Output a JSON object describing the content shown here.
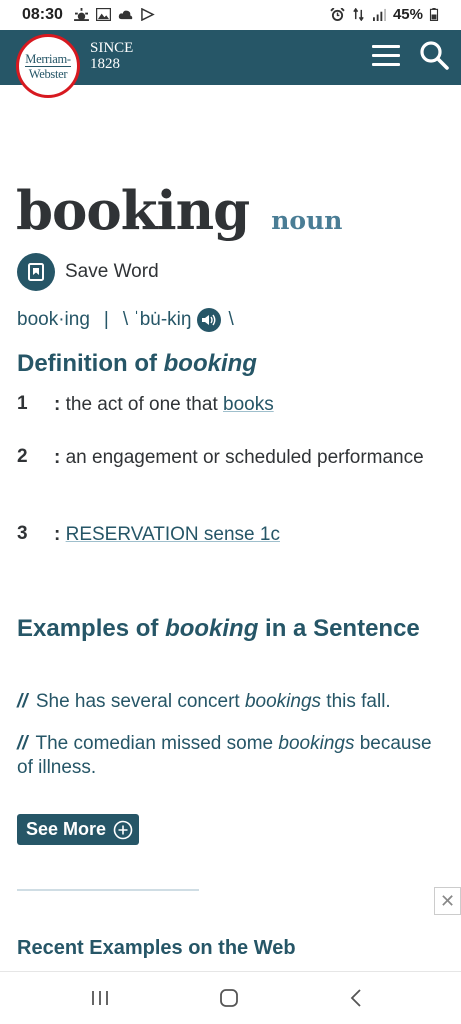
{
  "status_bar": {
    "time": "08:30",
    "battery": "45%",
    "left_icons": [
      "weather-icon",
      "gallery-icon",
      "cloud-icon",
      "play-store-icon"
    ],
    "right_icons": [
      "alarm-icon",
      "data-icon",
      "signal-icon",
      "battery-icon"
    ]
  },
  "header": {
    "logo_line1": "Merriam-",
    "logo_line2": "Webster",
    "since_line1": "SINCE",
    "since_line2": "1828",
    "menu_icon": "hamburger-menu-icon",
    "search_icon": "search-icon",
    "bg_color": "#265667",
    "logo_ring_color": "#d71920"
  },
  "entry": {
    "headword": "booking",
    "part_of_speech": "noun",
    "save_label": "Save Word",
    "syllables": "book·ing",
    "separator": "|",
    "pron_open": "\\ ˈbu̇-kiŋ",
    "pron_close": "\\"
  },
  "definition": {
    "title_prefix": "Definition of ",
    "title_word": "booking",
    "senses": [
      {
        "num": "1",
        "colon": ":",
        "text": " the act of one that ",
        "link": "books"
      },
      {
        "num": "2",
        "colon": ":",
        "text": " an engagement or scheduled performance"
      },
      {
        "num": "3",
        "colon": ":",
        "text": " ",
        "link": "RESERVATION sense 1c"
      }
    ]
  },
  "examples": {
    "title_prefix": "Examples of ",
    "title_word": "booking",
    "title_suffix": " in a Sentence",
    "marker": "//",
    "items": [
      {
        "before": " She has several concert ",
        "word": "bookings",
        "after": " this fall."
      },
      {
        "before": " The comedian missed some ",
        "word": "bookings",
        "after": " because of illness."
      }
    ],
    "see_more_label": "See More"
  },
  "ad": {
    "close_label": "✕"
  },
  "recent": {
    "title": "Recent Examples on the Web"
  },
  "nav_bar": {
    "icons": [
      "recent-apps-icon",
      "home-icon",
      "back-icon"
    ]
  },
  "colors": {
    "accent": "#265667",
    "pos": "#4a7d95",
    "text": "#303336"
  }
}
